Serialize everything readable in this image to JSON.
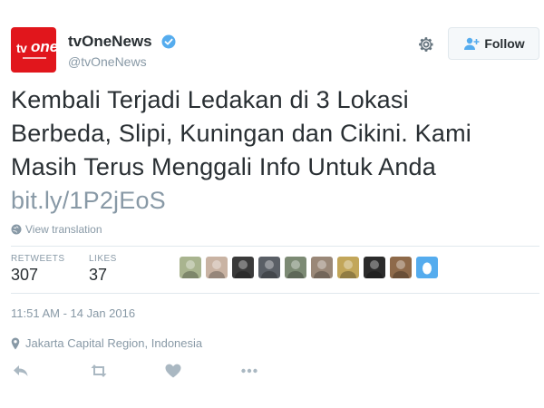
{
  "account": {
    "avatar_icon": "tvone-logo",
    "avatar_text_tv": "tv",
    "avatar_text_one": "one",
    "name": "tvOneNews",
    "handle": "@tvOneNews",
    "verified_icon": "verified-badge-icon"
  },
  "header": {
    "settings_icon": "gear-icon",
    "follow_label": "Follow",
    "follow_icon": "add-user-icon"
  },
  "tweet": {
    "lines": [
      "Kembali Terjadi Ledakan di 3 Lokasi",
      "Berbeda, Slipi, Kuningan dan Cikini. Kami",
      "Masih Terus Menggali Info Untuk Anda"
    ],
    "link": "bit.ly/1P2jEoS",
    "translate_label": "View translation"
  },
  "stats": {
    "retweets_label": "RETWEETS",
    "retweets_value": "307",
    "likes_label": "LIKES",
    "likes_value": "37"
  },
  "likers": [
    {
      "color": "#a9b48f"
    },
    {
      "color": "#c9b3a3"
    },
    {
      "color": "#3a3a3a"
    },
    {
      "color": "#5a5f66"
    },
    {
      "color": "#7c8a74"
    },
    {
      "color": "#9a8878"
    },
    {
      "color": "#c2a65a"
    },
    {
      "color": "#2b2b2b"
    },
    {
      "color": "#8e6a4a"
    },
    {
      "color": "#55acee",
      "egg": true
    }
  ],
  "meta": {
    "timestamp": "11:51 AM - 14 Jan 2016",
    "location": "Jakarta Capital Region, Indonesia"
  },
  "actions": {
    "reply_icon": "reply-icon",
    "retweet_icon": "retweet-icon",
    "like_icon": "heart-icon",
    "more_icon": "more-icon"
  },
  "colors": {
    "brand_red": "#e1161c",
    "verified_blue": "#55acee",
    "muted_text": "#8899a6",
    "main_text": "#292f33"
  }
}
